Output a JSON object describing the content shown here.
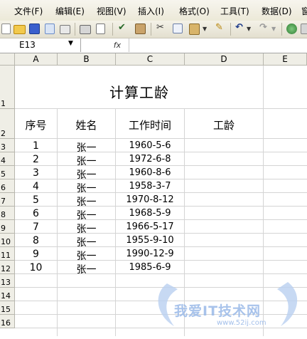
{
  "menu": [
    "文件(F)",
    "编辑(E)",
    "视图(V)",
    "插入(I)",
    "格式(O)",
    "工具(T)",
    "数据(D)",
    "窗"
  ],
  "name_box": "E13",
  "fx_label": "fx",
  "columns": [
    "A",
    "B",
    "C",
    "D",
    "E"
  ],
  "rows": [
    "1",
    "2",
    "3",
    "4",
    "5",
    "6",
    "7",
    "8",
    "9",
    "10",
    "11",
    "12",
    "13",
    "14",
    "15",
    "16"
  ],
  "sheet": {
    "title": "计算工龄",
    "headers": [
      "序号",
      "姓名",
      "工作时间",
      "工龄"
    ],
    "records": [
      [
        "1",
        "张一",
        "1960-5-6"
      ],
      [
        "2",
        "张一",
        "1972-6-8"
      ],
      [
        "3",
        "张一",
        "1960-8-6"
      ],
      [
        "4",
        "张一",
        "1958-3-7"
      ],
      [
        "5",
        "张一",
        "1970-8-12"
      ],
      [
        "6",
        "张一",
        "1968-5-9"
      ],
      [
        "7",
        "张一",
        "1966-5-17"
      ],
      [
        "8",
        "张一",
        "1955-9-10"
      ],
      [
        "9",
        "张一",
        "1990-12-9"
      ],
      [
        "10",
        "张一",
        "1985-6-9"
      ]
    ]
  },
  "watermark": {
    "text": "我爱IT技术网",
    "url": "www.52ij.com"
  }
}
